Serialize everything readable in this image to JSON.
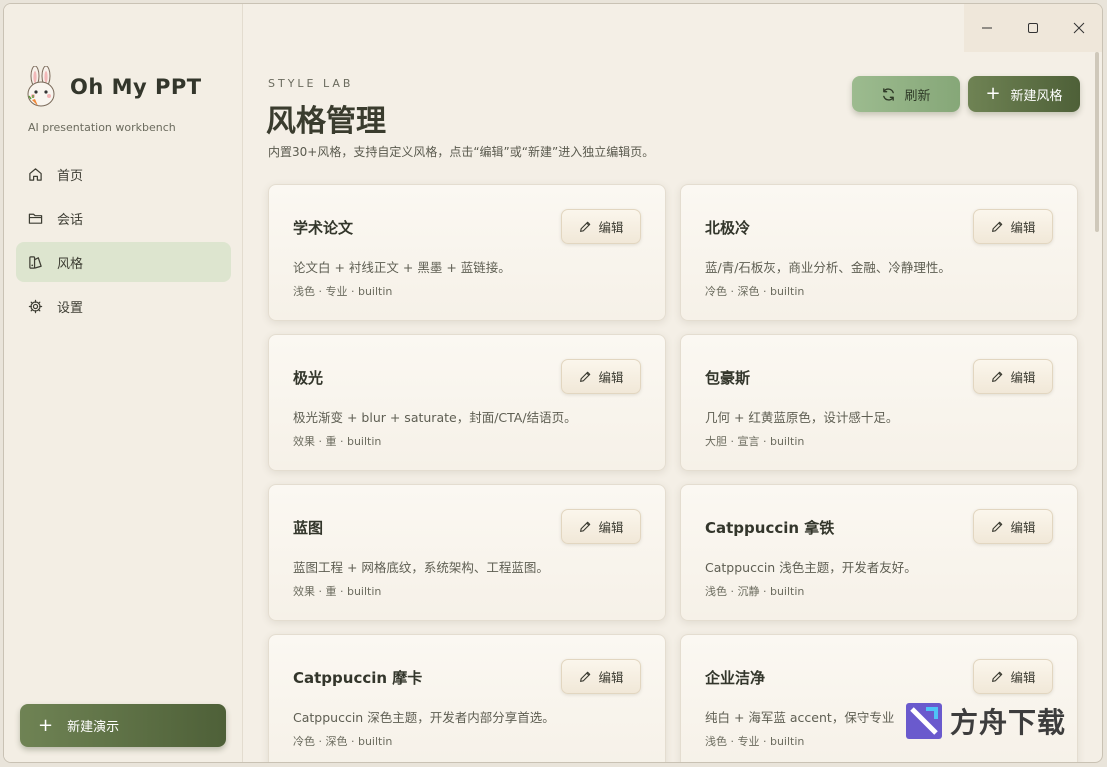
{
  "window_controls": {
    "minimize": "minimize",
    "maximize": "maximize",
    "close": "close"
  },
  "sidebar": {
    "app_name": "Oh My PPT",
    "tagline": "AI presentation workbench",
    "items": [
      {
        "label": "首页",
        "icon": "home-icon"
      },
      {
        "label": "会话",
        "icon": "folder-icon"
      },
      {
        "label": "风格",
        "icon": "palette-icon",
        "active": true
      },
      {
        "label": "设置",
        "icon": "gear-icon"
      }
    ],
    "new_presentation": "新建演示"
  },
  "header": {
    "kicker": "STYLE LAB",
    "title": "风格管理",
    "description": "内置30+风格，支持自定义风格，点击“编辑”或“新建”进入独立编辑页。",
    "refresh_label": "刷新",
    "new_style_label": "新建风格"
  },
  "cards": [
    {
      "title": "学术论文",
      "desc": "论文白 + 衬线正文 + 黑墨 + 蓝链接。",
      "meta": "浅色 · 专业 · builtin",
      "edit": "编辑"
    },
    {
      "title": "北极冷",
      "desc": "蓝/青/石板灰，商业分析、金融、冷静理性。",
      "meta": "冷色 · 深色 · builtin",
      "edit": "编辑"
    },
    {
      "title": "极光",
      "desc": "极光渐变 + blur + saturate，封面/CTA/结语页。",
      "meta": "效果 · 重 · builtin",
      "edit": "编辑"
    },
    {
      "title": "包豪斯",
      "desc": "几何 + 红黄蓝原色，设计感十足。",
      "meta": "大胆 · 宣言 · builtin",
      "edit": "编辑"
    },
    {
      "title": "蓝图",
      "desc": "蓝图工程 + 网格底纹，系统架构、工程蓝图。",
      "meta": "效果 · 重 · builtin",
      "edit": "编辑"
    },
    {
      "title": "Catppuccin 拿铁",
      "desc": "Catppuccin 浅色主题，开发者友好。",
      "meta": "浅色 · 沉静 · builtin",
      "edit": "编辑"
    },
    {
      "title": "Catppuccin 摩卡",
      "desc": "Catppuccin 深色主题，开发者内部分享首选。",
      "meta": "冷色 · 深色 · builtin",
      "edit": "编辑"
    },
    {
      "title": "企业洁净",
      "desc": "纯白 + 海军蓝 accent，保守专业",
      "meta": "浅色 · 专业 · builtin",
      "edit": "编辑"
    }
  ],
  "watermark": {
    "text": "方舟下载"
  },
  "colors": {
    "accent": "#5c6f45",
    "active_nav": "#dde5cf",
    "background": "#f4efe6"
  }
}
